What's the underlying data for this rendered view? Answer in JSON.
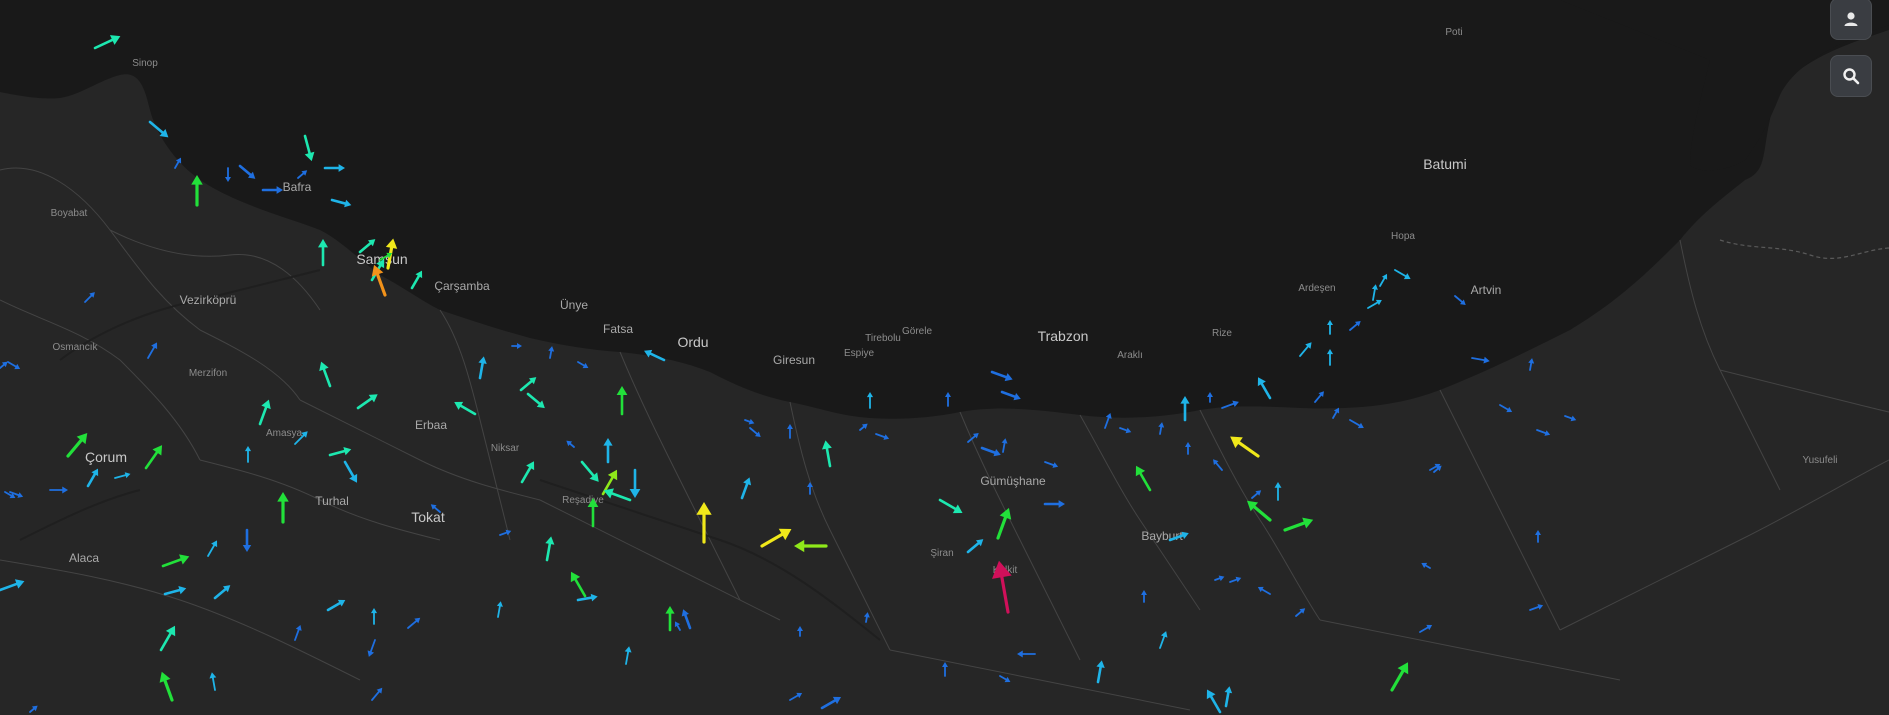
{
  "map": {
    "colors": {
      "land": "#262626",
      "sea": "#191919",
      "border": "#4a4a4a",
      "label": "#a9a9a9"
    },
    "places": [
      {
        "id": "sinop",
        "name": "Sinop",
        "size": "sm"
      },
      {
        "id": "bafra",
        "name": "Bafra",
        "size": "mid"
      },
      {
        "id": "boyabat",
        "name": "Boyabat",
        "size": "sm"
      },
      {
        "id": "samsun",
        "name": "Samsun",
        "size": "big"
      },
      {
        "id": "carsamba",
        "name": "Çarşamba",
        "size": "mid"
      },
      {
        "id": "vezirkopru",
        "name": "Vezirköprü",
        "size": "mid"
      },
      {
        "id": "osmancik",
        "name": "Osmancık",
        "size": "sm"
      },
      {
        "id": "merzifon",
        "name": "Merzifon",
        "size": "sm"
      },
      {
        "id": "amasya",
        "name": "Amasya",
        "size": "sm"
      },
      {
        "id": "corum",
        "name": "Çorum",
        "size": "big"
      },
      {
        "id": "erbaa",
        "name": "Erbaa",
        "size": "mid"
      },
      {
        "id": "niksar",
        "name": "Niksar",
        "size": "sm"
      },
      {
        "id": "turhal",
        "name": "Turhal",
        "size": "mid"
      },
      {
        "id": "tokat",
        "name": "Tokat",
        "size": "big"
      },
      {
        "id": "alaca",
        "name": "Alaca",
        "size": "mid"
      },
      {
        "id": "resadiye",
        "name": "Reşadiye",
        "size": "sm"
      },
      {
        "id": "unye",
        "name": "Ünye",
        "size": "mid"
      },
      {
        "id": "fatsa",
        "name": "Fatsa",
        "size": "mid"
      },
      {
        "id": "ordu",
        "name": "Ordu",
        "size": "big"
      },
      {
        "id": "giresun",
        "name": "Giresun",
        "size": "mid"
      },
      {
        "id": "espiye",
        "name": "Espiye",
        "size": "sm"
      },
      {
        "id": "tirebolu",
        "name": "Tirebolu",
        "size": "sm"
      },
      {
        "id": "gorele",
        "name": "Görele",
        "size": "sm"
      },
      {
        "id": "trabzon",
        "name": "Trabzon",
        "size": "big"
      },
      {
        "id": "akcaabat",
        "name": "Araklı",
        "size": "sm"
      },
      {
        "id": "rize",
        "name": "Rize",
        "size": "sm"
      },
      {
        "id": "ardesen",
        "name": "Ardeşen",
        "size": "sm"
      },
      {
        "id": "hopa",
        "name": "Hopa",
        "size": "sm"
      },
      {
        "id": "artvin",
        "name": "Artvin",
        "size": "mid"
      },
      {
        "id": "batumi",
        "name": "Batumi",
        "size": "big"
      },
      {
        "id": "poti",
        "name": "Poti",
        "size": "sm"
      },
      {
        "id": "gumushane",
        "name": "Gümüşhane",
        "size": "mid"
      },
      {
        "id": "bayburt",
        "name": "Bayburt",
        "size": "mid"
      },
      {
        "id": "siran",
        "name": "Şiran",
        "size": "sm"
      },
      {
        "id": "kelkit",
        "name": "Kelkit",
        "size": "sm"
      },
      {
        "id": "yusufeli",
        "name": "Yusufeli",
        "size": "sm"
      }
    ],
    "wind_colors": {
      "calm": "#1f6fe0",
      "light": "#1fb4e8",
      "gentle": "#1de8b0",
      "moderate": "#22e03a",
      "fresh": "#8fe81a",
      "strong": "#f0e81a",
      "near_gale": "#f2921a",
      "gale": "#d0105a"
    }
  },
  "controls": {
    "user_button": {
      "icon": "user-icon"
    },
    "search_button": {
      "icon": "search-icon"
    }
  }
}
